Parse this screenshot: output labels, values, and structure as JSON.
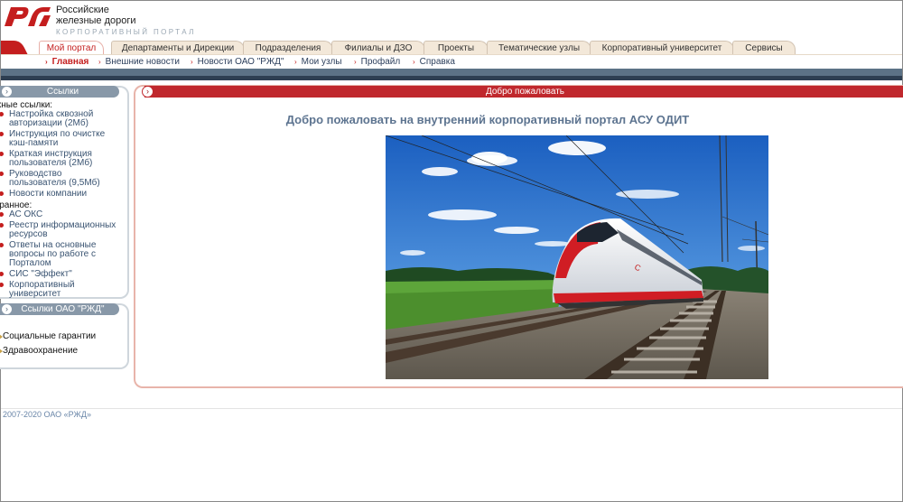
{
  "header": {
    "logo_line1": "Российские",
    "logo_line2": "железные дороги",
    "logo_line3": "КОРПОРАТИВНЫЙ ПОРТАЛ",
    "logo_mark_text": "РЖД"
  },
  "tabs": [
    {
      "label": "Мой портал",
      "active": true
    },
    {
      "label": "Департаменты и Дирекции",
      "active": false
    },
    {
      "label": "Подразделения",
      "active": false
    },
    {
      "label": "Филиалы и ДЗО",
      "active": false
    },
    {
      "label": "Проекты",
      "active": false
    },
    {
      "label": "Тематические узлы",
      "active": false
    },
    {
      "label": "Корпоративный университет",
      "active": false
    },
    {
      "label": "Сервисы",
      "active": false
    }
  ],
  "subnav": [
    {
      "label": "Главная",
      "active": true
    },
    {
      "label": "Внешние новости",
      "active": false
    },
    {
      "label": "Новости ОАО \"РЖД\"",
      "active": false
    },
    {
      "label": "Мои узлы",
      "active": false
    },
    {
      "label": "Профайл",
      "active": false
    },
    {
      "label": "Справка",
      "active": false
    }
  ],
  "sidebar": {
    "links_title": "Ссылки",
    "important_title": "ажные ссылки:",
    "important_links": [
      "Настройка сквозной авторизации (2Мб)",
      "Инструкция по очистке кэш-памяти",
      "Краткая инструкция пользователя (2Мб)",
      "Руководство пользователя (9,5Мб)",
      "Новости компании"
    ],
    "favorites_title": "збранное:",
    "favorite_links": [
      "АС ОКС",
      "Реестр информационных ресурсов",
      "Ответы на основные вопросы по работе с Порталом",
      "СИС \"Эффект\"",
      "Корпоративный университет"
    ],
    "rzd_links_title": "Ссылки ОАО \"РЖД\"",
    "rzd_links": [
      "Социальные гарантии",
      "Здравоохранение"
    ]
  },
  "main": {
    "header": "Добро пожаловать",
    "welcome": "Добро пожаловать на внутренний корпоративный портал АСУ ОДИТ"
  },
  "footer": {
    "copyright": "2007-2020 ОАО «РЖД»"
  },
  "colors": {
    "brand_red": "#c41e1e",
    "nav_blue": "#2c3f5c",
    "band_slate": "#5c7286"
  }
}
